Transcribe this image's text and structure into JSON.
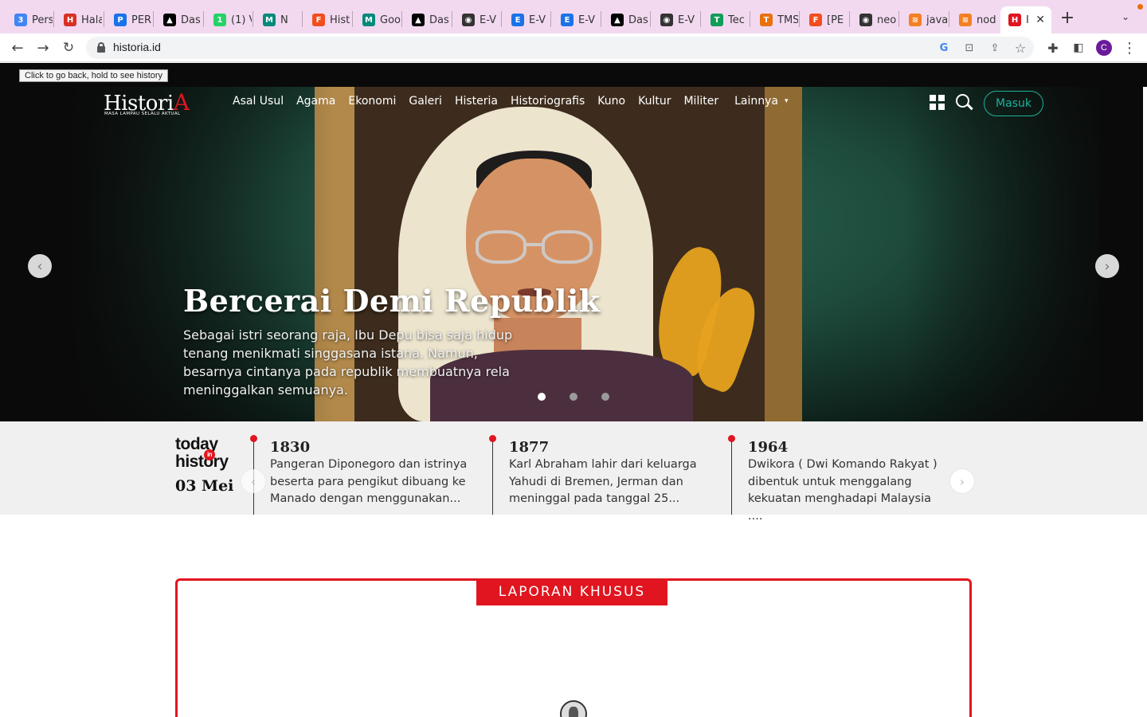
{
  "browser": {
    "tabs": [
      {
        "title": "Pers",
        "color": "#4285f4",
        "glyph": "3"
      },
      {
        "title": "Hala",
        "color": "#d93025",
        "glyph": "H"
      },
      {
        "title": "PER",
        "color": "#1a73e8",
        "glyph": "P"
      },
      {
        "title": "Das",
        "color": "#000000",
        "glyph": "▲"
      },
      {
        "title": "(1) V",
        "color": "#25d366",
        "glyph": "1"
      },
      {
        "title": "N",
        "color": "#00897b",
        "glyph": "M"
      },
      {
        "title": "Hist",
        "color": "#f24e1e",
        "glyph": "F"
      },
      {
        "title": "Goo",
        "color": "#00897b",
        "glyph": "M"
      },
      {
        "title": "Das",
        "color": "#000000",
        "glyph": "▲"
      },
      {
        "title": "E-V",
        "color": "#333333",
        "glyph": "◉"
      },
      {
        "title": "E-V",
        "color": "#1a73e8",
        "glyph": "E"
      },
      {
        "title": "E-V",
        "color": "#1a73e8",
        "glyph": "E"
      },
      {
        "title": "Das",
        "color": "#000000",
        "glyph": "▲"
      },
      {
        "title": "E-V",
        "color": "#333333",
        "glyph": "◉"
      },
      {
        "title": "Tec",
        "color": "#0f9d58",
        "glyph": "T"
      },
      {
        "title": "TMS",
        "color": "#e8710a",
        "glyph": "T"
      },
      {
        "title": "[PE",
        "color": "#f24e1e",
        "glyph": "F"
      },
      {
        "title": "neo",
        "color": "#333333",
        "glyph": "◉"
      },
      {
        "title": "java",
        "color": "#f48024",
        "glyph": "≋"
      },
      {
        "title": "nod",
        "color": "#f48024",
        "glyph": "≋"
      },
      {
        "title": "I",
        "color": "#e0151f",
        "glyph": "H"
      }
    ],
    "url": "historia.id",
    "profile_initial": "C",
    "tooltip": "Click to go back, hold to see history"
  },
  "site": {
    "logo_text": "Histori",
    "logo_accent": "A",
    "logo_tagline": "MASA LAMPAU SELALU AKTUAL",
    "nav": [
      "Asal Usul",
      "Agama",
      "Ekonomi",
      "Galeri",
      "Histeria",
      "Historiografis",
      "Kuno",
      "Kultur",
      "Militer",
      "Lainnya"
    ],
    "login_label": "Masuk",
    "accent_color": "#e0151f",
    "teal_color": "#1fb29a"
  },
  "hero": {
    "title": "Bercerai Demi Republik",
    "description": "Sebagai istri seorang raja, Ibu Depu bisa saja hidup tenang menikmati singgasana istana. Namun, besarnya cintanya pada republik membuatnya rela meninggalkan semuanya.",
    "prev_arrow": "‹",
    "next_arrow": "›",
    "slide_count": 3,
    "active_slide": 1
  },
  "today_in_history": {
    "logo_line1": "today",
    "logo_in": "in",
    "logo_line2": "history",
    "date": "03 Mei",
    "items": [
      {
        "year": "1830",
        "text": "Pangeran Diponegoro dan istrinya beserta para pengikut dibuang ke Manado dengan menggunakan..."
      },
      {
        "year": "1877",
        "text": "Karl Abraham lahir dari keluarga Yahudi di Bremen, Jerman dan meninggal pada tanggal 25..."
      },
      {
        "year": "1964",
        "text": "Dwikora ( Dwi Komando Rakyat ) dibentuk untuk menggalang kekuatan menghadapi Malaysia ...."
      }
    ],
    "prev_arrow": "‹",
    "next_arrow": "›"
  },
  "special_report": {
    "label": "LAPORAN KHUSUS"
  }
}
